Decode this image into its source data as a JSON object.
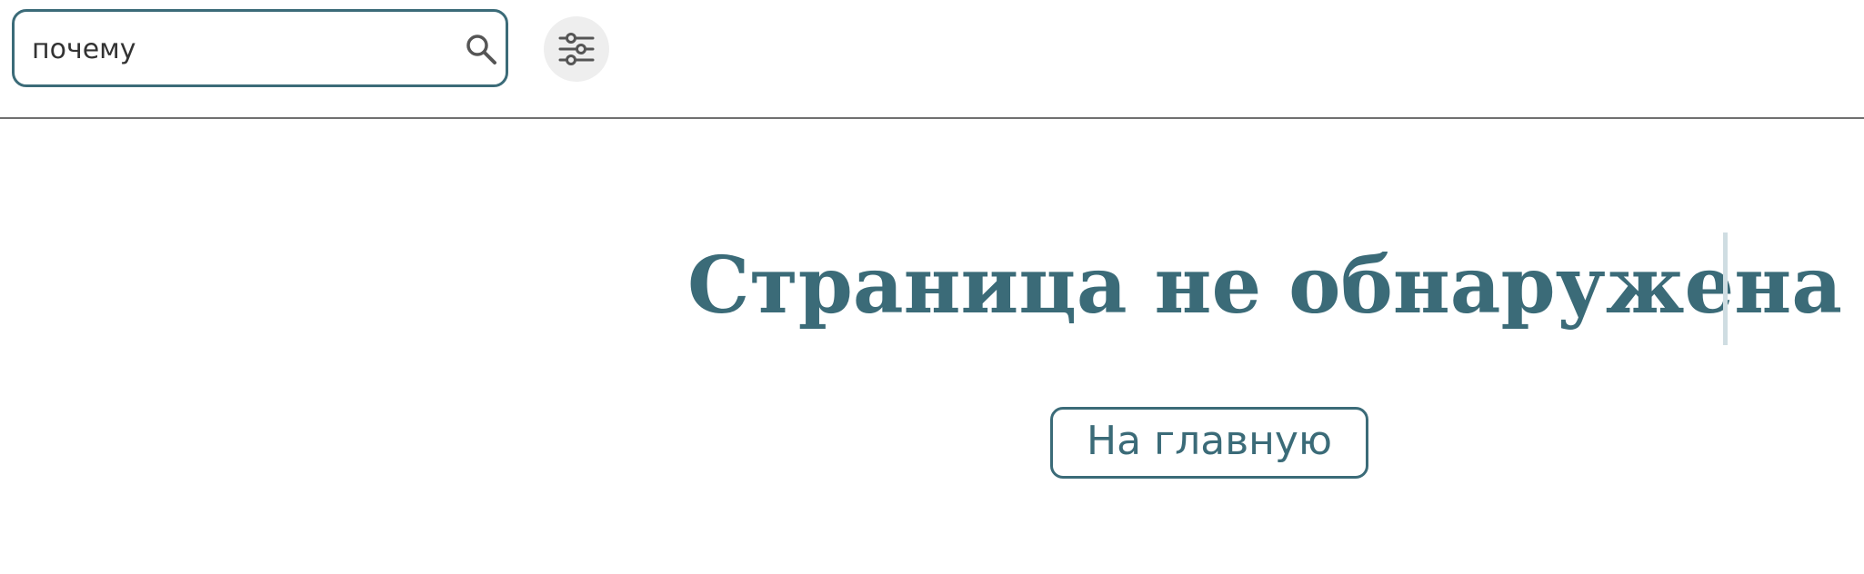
{
  "search": {
    "value": "почему",
    "icon": "search-icon"
  },
  "filters": {
    "icon": "sliders-icon"
  },
  "error_page": {
    "title": "Страница не обнаружена",
    "home_button_label": "На главную"
  },
  "colors": {
    "accent": "#3b6b78",
    "divider": "#707070",
    "filter_button_bg": "#eeeeee",
    "cursor": "#cfdde2",
    "icon": "#555555"
  }
}
